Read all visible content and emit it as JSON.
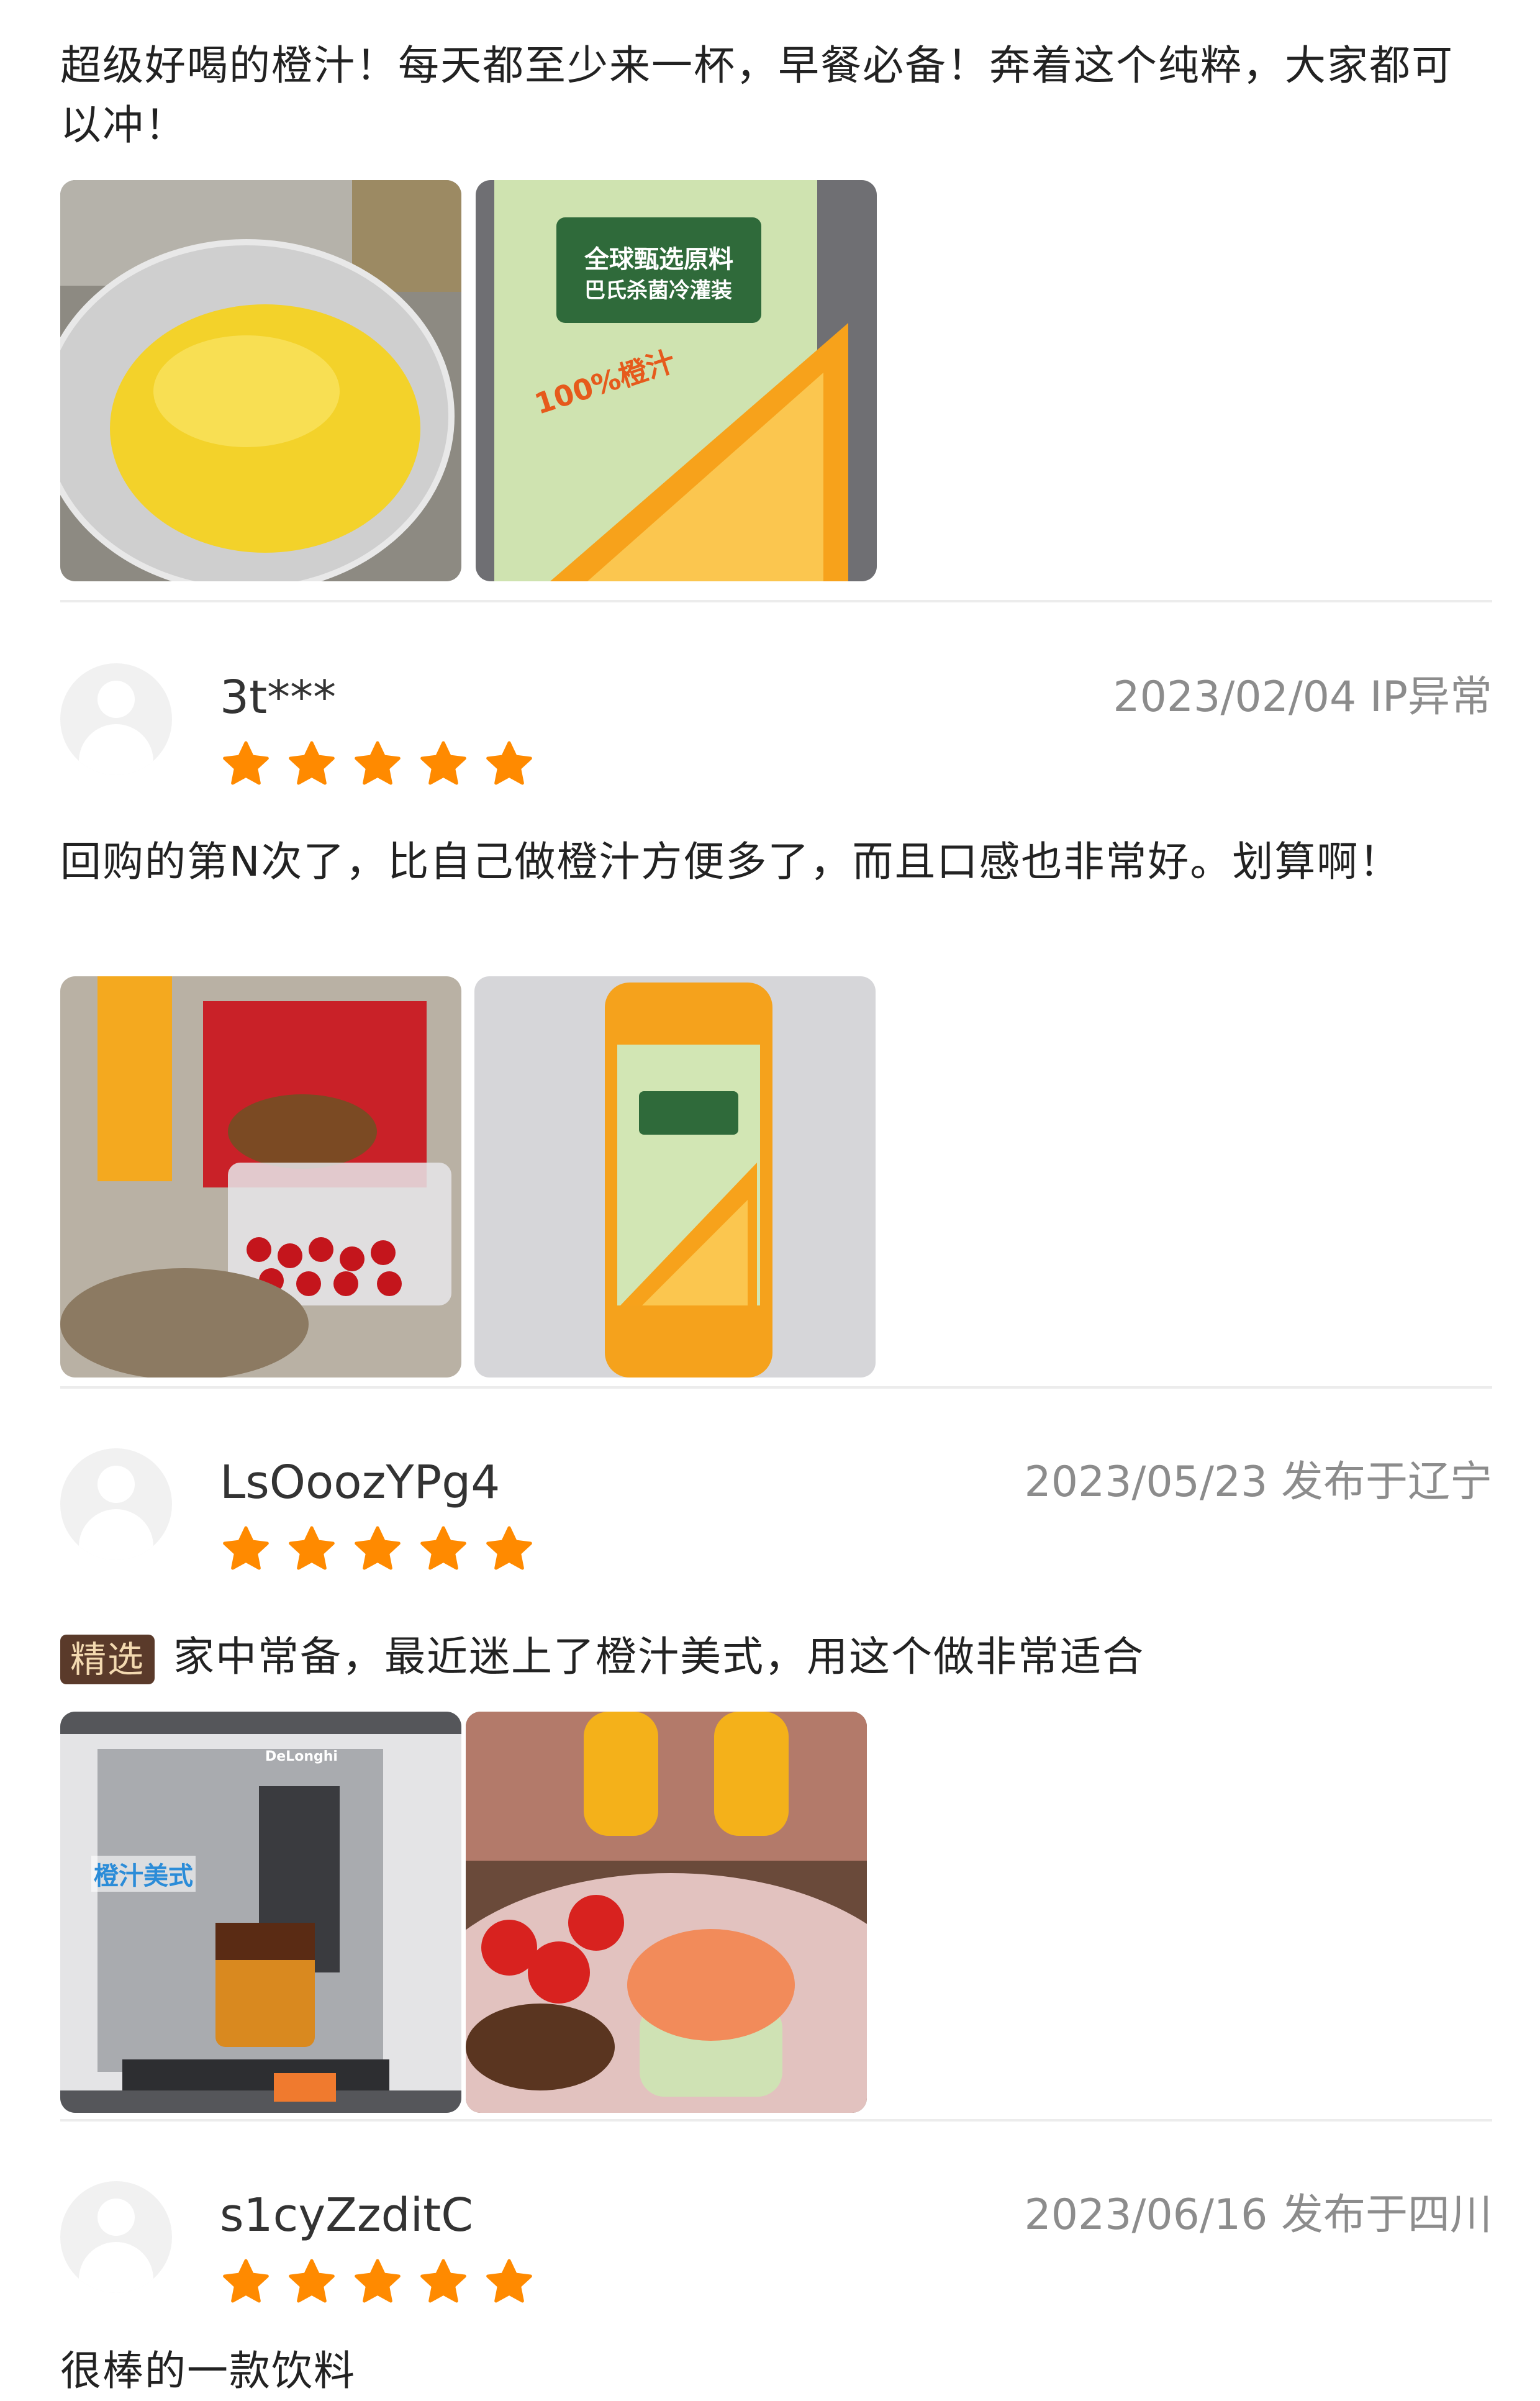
{
  "reviews": [
    {
      "text": "超级好喝的橙汁！每天都至少来一杯，早餐必备！奔着这个纯粹，大家都可以冲！",
      "photos": [
        "juice-in-glass",
        "juice-bottle-label"
      ]
    },
    {
      "user": "3t***",
      "meta": "2023/02/04 IP异常",
      "rating": 5,
      "text": "回购的第N次了，比自己做橙汁方便多了，而且口感也非常好。划算啊！",
      "photos": [
        "groceries-with-juice",
        "juice-bottle"
      ]
    },
    {
      "user": "LsOoozYPg4",
      "meta": "2023/05/23 发布于辽宁",
      "rating": 5,
      "badge": "精选",
      "text": "家中常备，最近迷上了橙汁美式，用这个做非常适合",
      "photos": [
        "coffee-machine-orange-americano",
        "salmon-dish-with-juice"
      ]
    },
    {
      "user": "s1cyZzditC",
      "meta": "2023/06/16 发布于四川",
      "rating": 5,
      "text": "很棒的一款饮料"
    }
  ],
  "photo_text": {
    "label_line1": "全球甄选原料",
    "label_line2": "巴氏杀菌冷灌装",
    "label_percent": "100%橙汁",
    "overlay": "橙汁美式",
    "brand": "DeLonghi"
  },
  "colors": {
    "star": "#ff8a00",
    "badge_bg": "#5a3a2a",
    "meta": "#8c8c8c"
  },
  "icons": {
    "star": "star-icon",
    "avatar": "default-avatar-icon"
  }
}
